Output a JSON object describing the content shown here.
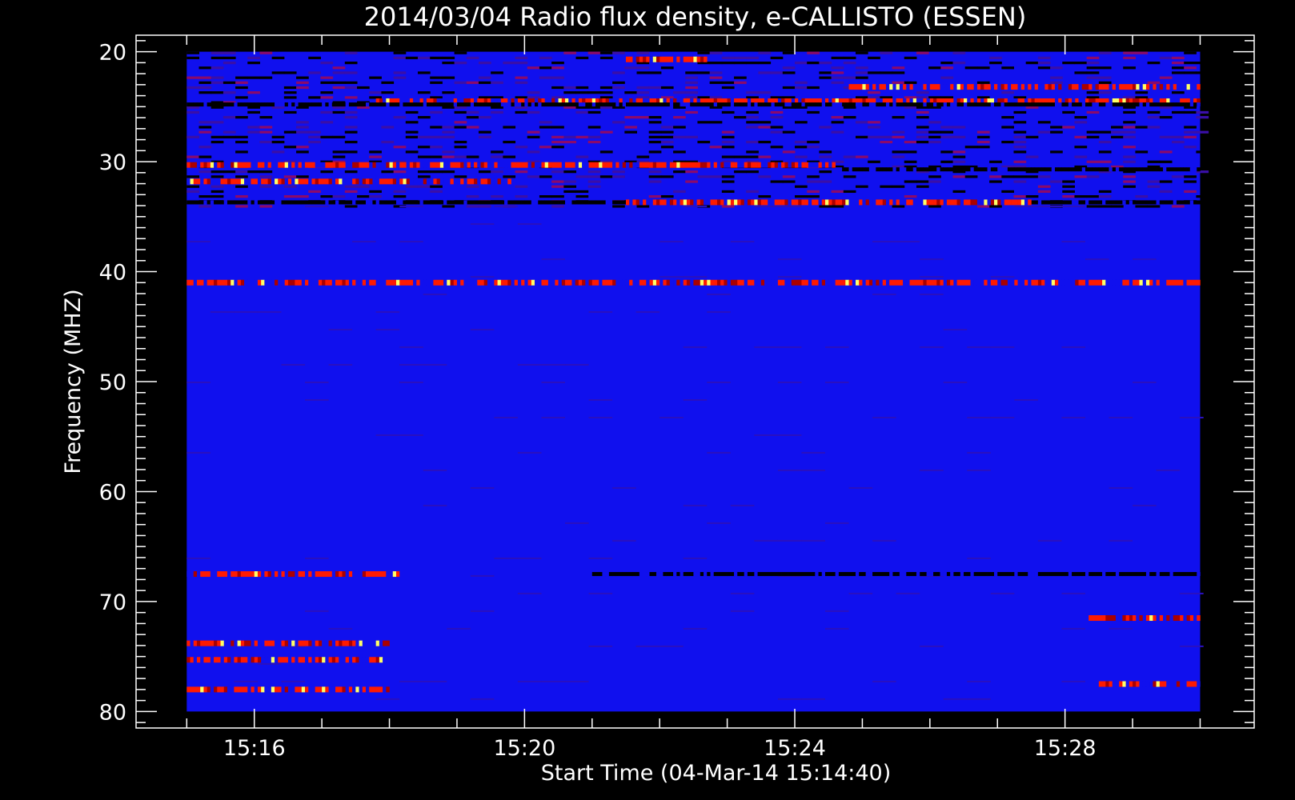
{
  "chart_data": {
    "type": "heatmap",
    "title": "2014/03/04  Radio flux density, e-CALLISTO (ESSEN)",
    "xlabel": "Start Time (04-Mar-14 15:14:40)",
    "ylabel": "Frequency (MHZ)",
    "x_ticks": [
      "15:16",
      "15:20",
      "15:24",
      "15:28"
    ],
    "x_tick_minutes": [
      16,
      20,
      24,
      28
    ],
    "x_range_minutes": [
      14.25,
      30.8
    ],
    "data_time_range_minutes": [
      15.0,
      30.0
    ],
    "y_ticks": [
      20,
      30,
      40,
      50,
      60,
      70,
      80
    ],
    "ylim": [
      18.5,
      81.5
    ],
    "y_inverted": true,
    "data_freq_range": [
      20,
      80
    ],
    "colormap": [
      "#000000",
      "#0000ff",
      "#ff0000",
      "#ffff66"
    ],
    "background_color": "#1010ee",
    "notable_features": [
      {
        "kind": "interference band",
        "freq": 20.7,
        "t_start": 21.5,
        "t_end": 22.7
      },
      {
        "kind": "interference band",
        "freq": 23.2,
        "t_start": 24.8,
        "t_end": 30.0
      },
      {
        "kind": "interference band",
        "freq": 24.5,
        "t_start": 17.8,
        "t_end": 30.0
      },
      {
        "kind": "dark band",
        "freq": 24.8,
        "t_start": 15.0,
        "t_end": 30.0
      },
      {
        "kind": "interference band",
        "freq": 30.3,
        "t_start": 15.0,
        "t_end": 24.6
      },
      {
        "kind": "dark band",
        "freq": 30.7,
        "t_start": 24.6,
        "t_end": 30.0
      },
      {
        "kind": "interference band",
        "freq": 31.8,
        "t_start": 15.0,
        "t_end": 18.9
      },
      {
        "kind": "interference band",
        "freq": 31.8,
        "t_start": 18.9,
        "t_end": 19.8
      },
      {
        "kind": "dark band",
        "freq": 33.7,
        "t_start": 15.0,
        "t_end": 30.0
      },
      {
        "kind": "interference band",
        "freq": 33.7,
        "t_start": 21.5,
        "t_end": 27.5
      },
      {
        "kind": "interference band",
        "freq": 41.0,
        "t_start": 15.0,
        "t_end": 30.0
      },
      {
        "kind": "interference band",
        "freq": 67.5,
        "t_start": 15.0,
        "t_end": 18.2
      },
      {
        "kind": "dark band",
        "freq": 67.5,
        "t_start": 21.0,
        "t_end": 30.0
      },
      {
        "kind": "interference band",
        "freq": 71.5,
        "t_start": 28.3,
        "t_end": 30.0
      },
      {
        "kind": "interference band",
        "freq": 73.8,
        "t_start": 15.0,
        "t_end": 18.0
      },
      {
        "kind": "interference band",
        "freq": 75.3,
        "t_start": 15.0,
        "t_end": 18.0
      },
      {
        "kind": "interference band",
        "freq": 78.0,
        "t_start": 15.0,
        "t_end": 18.0
      },
      {
        "kind": "interference band",
        "freq": 77.5,
        "t_start": 28.5,
        "t_end": 30.0
      }
    ]
  }
}
